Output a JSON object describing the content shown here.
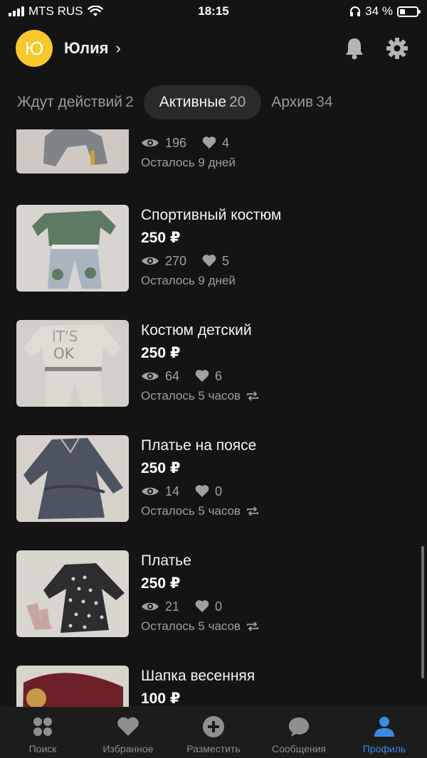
{
  "status_bar": {
    "carrier": "MTS RUS",
    "time": "18:15",
    "battery": "34 %",
    "battery_level": 0.34
  },
  "header": {
    "avatar_letter": "Ю",
    "username": "Юлия",
    "bell_icon": "bell-icon",
    "settings_icon": "gear-icon"
  },
  "tabs": [
    {
      "label": "Ждут действий",
      "count": "2"
    },
    {
      "label": "Активные",
      "count": "20"
    },
    {
      "label": "Архив",
      "count": "34"
    }
  ],
  "items": [
    {
      "title": "",
      "price": "",
      "views": "196",
      "likes": "4",
      "remaining": "Осталось 9 дней",
      "repeat": false
    },
    {
      "title": "Спортивный костюм",
      "price": "250 ₽",
      "views": "270",
      "likes": "5",
      "remaining": "Осталось 9 дней",
      "repeat": false
    },
    {
      "title": "Костюм детский",
      "price": "250 ₽",
      "views": "64",
      "likes": "6",
      "remaining": "Осталось 5 часов",
      "repeat": true
    },
    {
      "title": "Платье на поясе",
      "price": "250 ₽",
      "views": "14",
      "likes": "0",
      "remaining": "Осталось 5 часов",
      "repeat": true
    },
    {
      "title": "Платье",
      "price": "250 ₽",
      "views": "21",
      "likes": "0",
      "remaining": "Осталось 5 часов",
      "repeat": true
    },
    {
      "title": "Шапка весенняя",
      "price": "100 ₽",
      "views": "",
      "likes": "",
      "remaining": "",
      "repeat": false
    }
  ],
  "tabbar": [
    {
      "label": "Поиск",
      "icon": "search-dots-icon"
    },
    {
      "label": "Избранное",
      "icon": "heart-icon"
    },
    {
      "label": "Разместить",
      "icon": "plus-circle-icon"
    },
    {
      "label": "Сообщения",
      "icon": "chat-bubble-icon"
    },
    {
      "label": "Профиль",
      "icon": "person-icon"
    }
  ],
  "colors": {
    "background": "#141414",
    "avatar": "#f7c82b",
    "accent": "#3b8be6"
  }
}
